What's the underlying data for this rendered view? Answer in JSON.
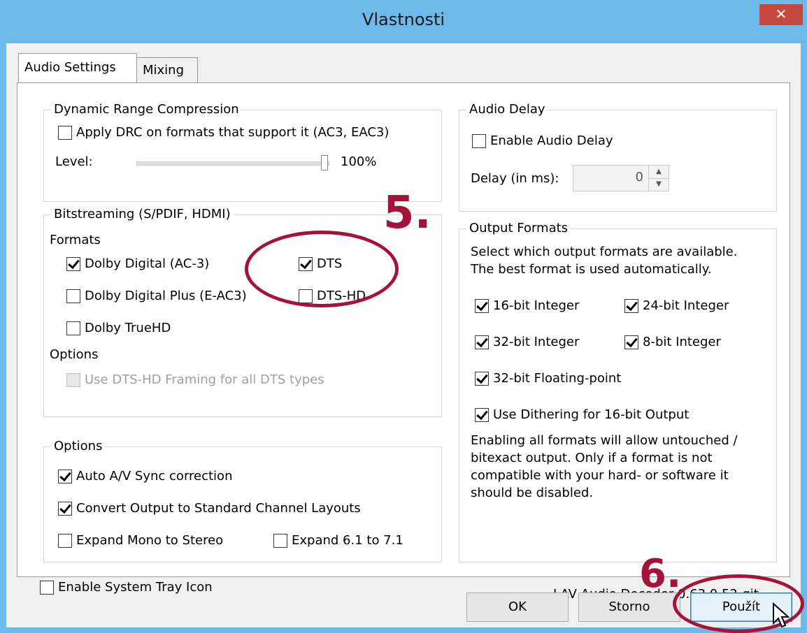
{
  "window": {
    "title": "Vlastnosti",
    "close_symbol": "✕"
  },
  "tabs": [
    {
      "label": "Audio Settings",
      "active": true
    },
    {
      "label": "Mixing",
      "active": false
    }
  ],
  "drc": {
    "title": "Dynamic Range Compression",
    "apply_label": "Apply DRC on formats that support it (AC3, EAC3)",
    "apply_checked": false,
    "level_label": "Level:",
    "level_value": "100%",
    "level_fraction": 1.0
  },
  "bitstreaming": {
    "title": "Bitstreaming (S/PDIF, HDMI)",
    "formats_label": "Formats",
    "formats": [
      {
        "label": "Dolby Digital (AC-3)",
        "checked": true
      },
      {
        "label": "DTS",
        "checked": true
      },
      {
        "label": "Dolby Digital Plus (E-AC3)",
        "checked": false
      },
      {
        "label": "DTS-HD",
        "checked": false
      },
      {
        "label": "Dolby TrueHD",
        "checked": false
      }
    ],
    "options_label": "Options",
    "framing_label": "Use DTS-HD Framing for all DTS types",
    "framing_enabled": false
  },
  "options": {
    "title": "Options",
    "items": [
      {
        "label": "Auto A/V Sync correction",
        "checked": true
      },
      {
        "label": "Convert Output to Standard Channel Layouts",
        "checked": true
      },
      {
        "label": "Expand Mono to Stereo",
        "checked": false
      },
      {
        "label": "Expand 6.1 to 7.1",
        "checked": false
      }
    ]
  },
  "audio_delay": {
    "title": "Audio Delay",
    "enable_label": "Enable Audio Delay",
    "enable_checked": false,
    "delay_label": "Delay (in ms):",
    "delay_value": "0"
  },
  "output_formats": {
    "title": "Output Formats",
    "description": "Select which output formats are available.\nThe best format is used automatically.",
    "items": [
      {
        "label": "16-bit Integer",
        "checked": true
      },
      {
        "label": "24-bit Integer",
        "checked": true
      },
      {
        "label": "32-bit Integer",
        "checked": true
      },
      {
        "label": "8-bit Integer",
        "checked": true
      },
      {
        "label": "32-bit Floating-point",
        "checked": true
      },
      {
        "label": "Use Dithering for 16-bit Output",
        "checked": true
      }
    ],
    "note": "Enabling all formats will allow untouched /\nbitexact output. Only if a format is not\ncompatible with your hard- or software it\nshould be disabled."
  },
  "tray": {
    "label": "Enable System Tray Icon",
    "checked": false
  },
  "version": "LAV Audio Decoder 0.63.0.52-git",
  "buttons": {
    "ok": "OK",
    "cancel": "Storno",
    "apply": "Použít"
  },
  "annotations": {
    "step5": "5.",
    "step6": "6.",
    "color": "#a4143a"
  }
}
